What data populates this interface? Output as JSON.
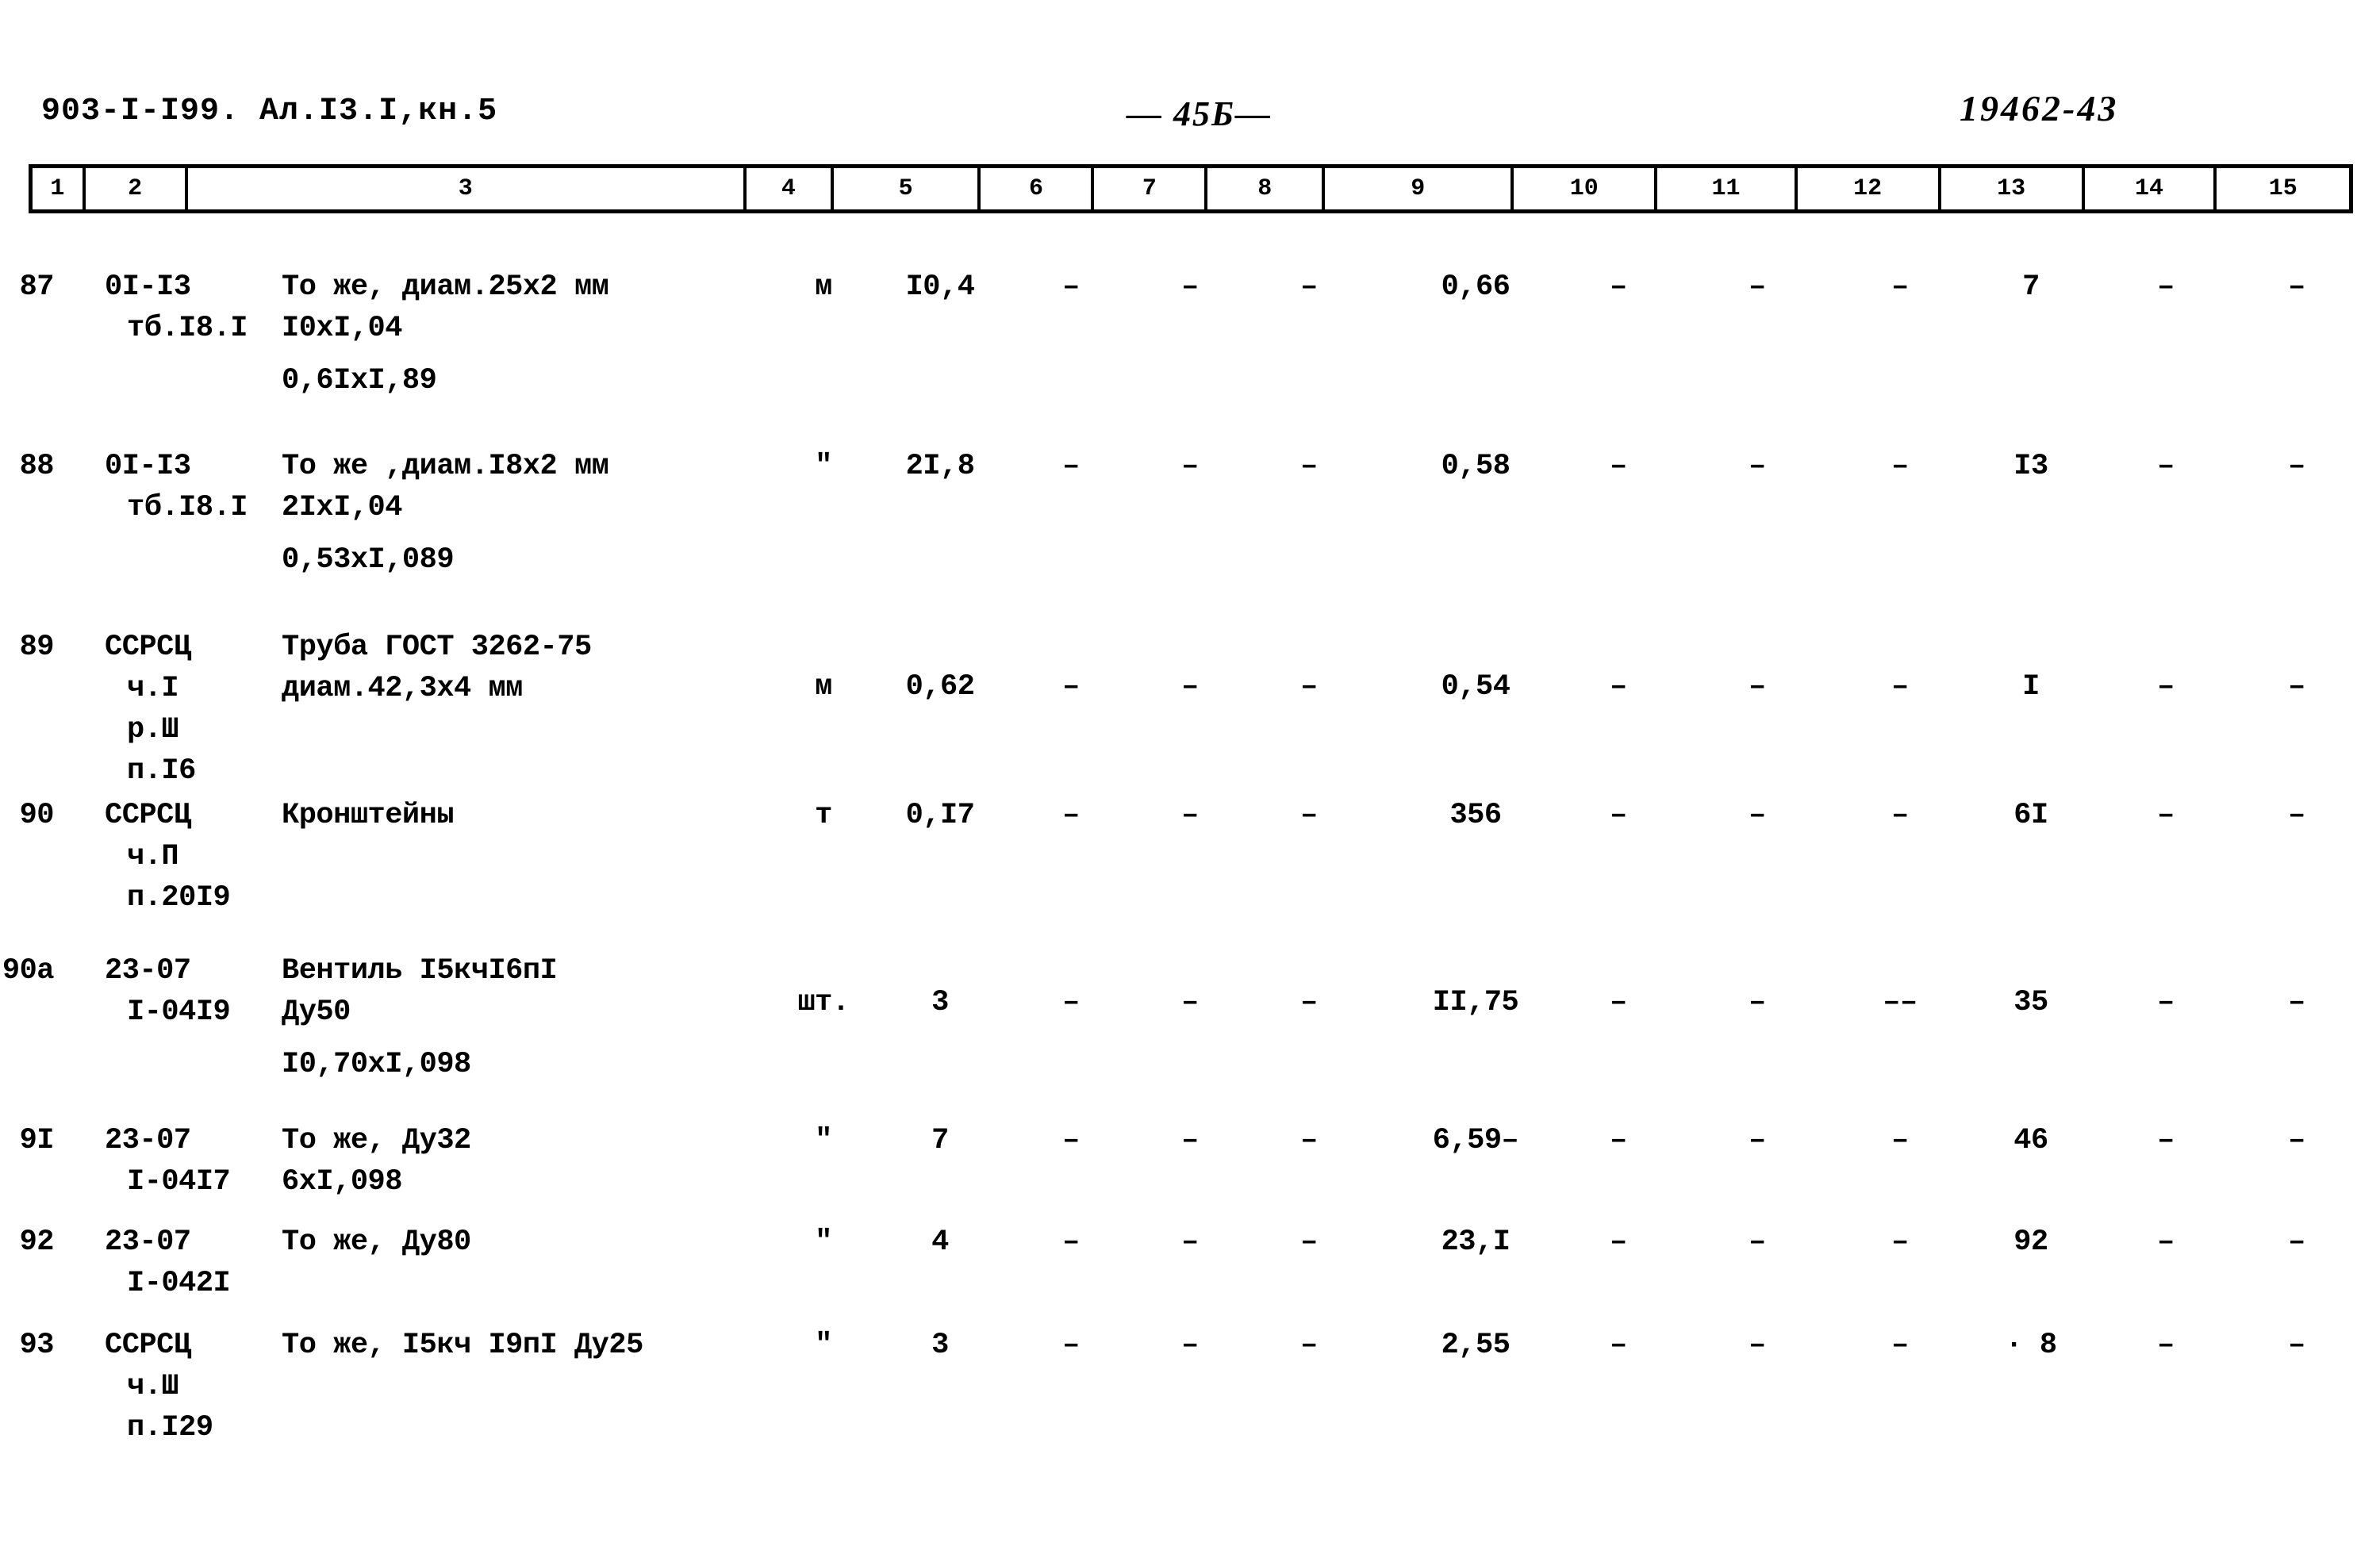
{
  "header": {
    "left": "903-I-I99. Ал.I3.I,кн.5",
    "page_number": "— 45Б—",
    "right": "19462-43"
  },
  "table": {
    "column_numbers": [
      "1",
      "2",
      "3",
      "4",
      "5",
      "6",
      "7",
      "8",
      "9",
      "10",
      "11",
      "12",
      "13",
      "14",
      "15"
    ],
    "rows": [
      {
        "pos": "87",
        "code_lines": [
          "0I-I3",
          "тб.I8.I"
        ],
        "name_lines": [
          "То же, диам.25х2 мм",
          "I0хI,04",
          "0,6IхI,89"
        ],
        "unit": "м",
        "c5": "I0,4",
        "c6": "–",
        "c7": "–",
        "c8": "–",
        "c9": "0,66",
        "c10": "–",
        "c11": "–",
        "c12": "–",
        "c13": "7",
        "c14": "–",
        "c15": "–"
      },
      {
        "pos": "88",
        "code_lines": [
          "0I-I3",
          "тб.I8.I"
        ],
        "name_lines": [
          "То же ,диам.I8х2 мм",
          "2IхI,04",
          "0,53хI,089"
        ],
        "unit": "\"",
        "c5": "2I,8",
        "c6": "–",
        "c7": "–",
        "c8": "–",
        "c9": "0,58",
        "c10": "–",
        "c11": "–",
        "c12": "–",
        "c13": "I3",
        "c14": "–",
        "c15": "–"
      },
      {
        "pos": "89",
        "code_lines": [
          "ССРСЦ",
          "ч.I",
          "р.Ш",
          "п.I6"
        ],
        "name_lines": [
          "Труба ГОСТ 3262-75",
          "диам.42,3х4 мм"
        ],
        "unit": "м",
        "c5": "0,62",
        "c6": "–",
        "c7": "–",
        "c8": "–",
        "c9": "0,54",
        "c10": "–",
        "c11": "–",
        "c12": "–",
        "c13": "I",
        "c14": "–",
        "c15": "–"
      },
      {
        "pos": "90",
        "code_lines": [
          "ССРСЦ",
          "ч.П",
          "п.20I9"
        ],
        "name_lines": [
          "Кронштейны"
        ],
        "unit": "т",
        "c5": "0,I7",
        "c6": "–",
        "c7": "–",
        "c8": "–",
        "c9": "356",
        "c10": "–",
        "c11": "–",
        "c12": "–",
        "c13": "6I",
        "c14": "–",
        "c15": "–"
      },
      {
        "pos": "90а",
        "code_lines": [
          "23-07",
          "I-04I9"
        ],
        "name_lines": [
          "Вентиль I5кчI6пI",
          "Ду50",
          "I0,70хI,098"
        ],
        "unit": "шт.",
        "c5": "3",
        "c6": "–",
        "c7": "–",
        "c8": "–",
        "c9": "II,75",
        "c10": "–",
        "c11": "–",
        "c12": "––",
        "c13": "35",
        "c14": "–",
        "c15": "–"
      },
      {
        "pos": "9I",
        "code_lines": [
          "23-07",
          "I-04I7"
        ],
        "name_lines": [
          "То же, Ду32",
          "6хI,098"
        ],
        "unit": "\"",
        "c5": "7",
        "c6": "–",
        "c7": "–",
        "c8": "–",
        "c9": "6,59–",
        "c10": "–",
        "c11": "–",
        "c12": "–",
        "c13": "46",
        "c14": "–",
        "c15": "–"
      },
      {
        "pos": "92",
        "code_lines": [
          "23-07",
          "I-042I"
        ],
        "name_lines": [
          "То же, Ду80"
        ],
        "unit": "\"",
        "c5": "4",
        "c6": "–",
        "c7": "–",
        "c8": "–",
        "c9": "23,I",
        "c10": "–",
        "c11": "–",
        "c12": "–",
        "c13": "92",
        "c14": "–",
        "c15": "–"
      },
      {
        "pos": "93",
        "code_lines": [
          "ССРСЦ",
          "ч.Ш",
          "п.I29"
        ],
        "name_lines": [
          "То же, I5кч I9пI Ду25"
        ],
        "unit": "\"",
        "c5": "3",
        "c6": "–",
        "c7": "–",
        "c8": "–",
        "c9": "2,55",
        "c10": "–",
        "c11": "–",
        "c12": "–",
        "c13": "· 8",
        "c14": "–",
        "c15": "–"
      }
    ]
  }
}
